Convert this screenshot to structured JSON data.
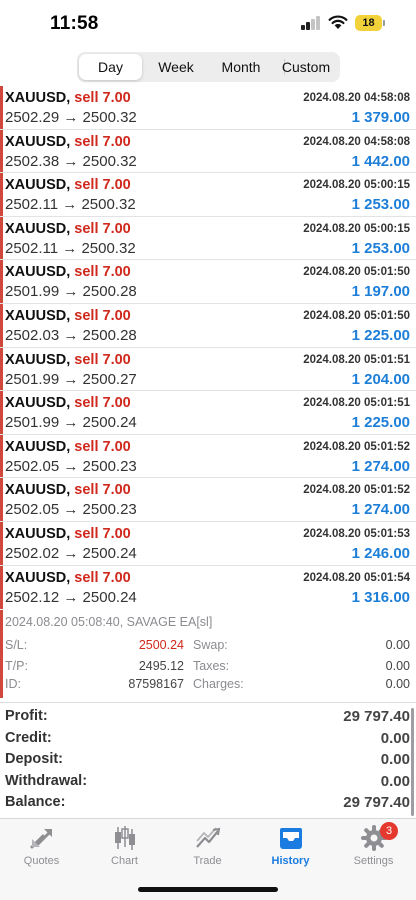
{
  "status": {
    "time": "11:58",
    "battery": "18"
  },
  "period_tabs": [
    {
      "label": "Day",
      "active": true
    },
    {
      "label": "Week",
      "active": false
    },
    {
      "label": "Month",
      "active": false
    },
    {
      "label": "Custom",
      "active": false
    }
  ],
  "deals": [
    {
      "symbol": "XAUUSD,",
      "side": "sell 7.00",
      "time": "2024.08.20 04:58:08",
      "prices": "2502.29 → 2500.32",
      "profit": "1 379.00"
    },
    {
      "symbol": "XAUUSD,",
      "side": "sell 7.00",
      "time": "2024.08.20 04:58:08",
      "prices": "2502.38 → 2500.32",
      "profit": "1 442.00"
    },
    {
      "symbol": "XAUUSD,",
      "side": "sell 7.00",
      "time": "2024.08.20 05:00:15",
      "prices": "2502.11 → 2500.32",
      "profit": "1 253.00"
    },
    {
      "symbol": "XAUUSD,",
      "side": "sell 7.00",
      "time": "2024.08.20 05:00:15",
      "prices": "2502.11 → 2500.32",
      "profit": "1 253.00"
    },
    {
      "symbol": "XAUUSD,",
      "side": "sell 7.00",
      "time": "2024.08.20 05:01:50",
      "prices": "2501.99 → 2500.28",
      "profit": "1 197.00"
    },
    {
      "symbol": "XAUUSD,",
      "side": "sell 7.00",
      "time": "2024.08.20 05:01:50",
      "prices": "2502.03 → 2500.28",
      "profit": "1 225.00"
    },
    {
      "symbol": "XAUUSD,",
      "side": "sell 7.00",
      "time": "2024.08.20 05:01:51",
      "prices": "2501.99 → 2500.27",
      "profit": "1 204.00"
    },
    {
      "symbol": "XAUUSD,",
      "side": "sell 7.00",
      "time": "2024.08.20 05:01:51",
      "prices": "2501.99 → 2500.24",
      "profit": "1 225.00"
    },
    {
      "symbol": "XAUUSD,",
      "side": "sell 7.00",
      "time": "2024.08.20 05:01:52",
      "prices": "2502.05 → 2500.23",
      "profit": "1 274.00"
    },
    {
      "symbol": "XAUUSD,",
      "side": "sell 7.00",
      "time": "2024.08.20 05:01:52",
      "prices": "2502.05 → 2500.23",
      "profit": "1 274.00"
    },
    {
      "symbol": "XAUUSD,",
      "side": "sell 7.00",
      "time": "2024.08.20 05:01:53",
      "prices": "2502.02 → 2500.24",
      "profit": "1 246.00"
    },
    {
      "symbol": "XAUUSD,",
      "side": "sell 7.00",
      "time": "2024.08.20 05:01:54",
      "prices": "2502.12 → 2500.24",
      "profit": "1 316.00"
    }
  ],
  "detail": {
    "header": "2024.08.20 05:08:40, SAVAGE EA[sl]",
    "sl_label": "S/L:",
    "sl_value": "2500.24",
    "tp_label": "T/P:",
    "tp_value": "2495.12",
    "id_label": "ID:",
    "id_value": "87598167",
    "swap_label": "Swap:",
    "swap_value": "0.00",
    "taxes_label": "Taxes:",
    "taxes_value": "0.00",
    "charges_label": "Charges:",
    "charges_value": "0.00"
  },
  "totals": [
    {
      "label": "Profit:",
      "value": "29 797.40"
    },
    {
      "label": "Credit:",
      "value": "0.00"
    },
    {
      "label": "Deposit:",
      "value": "0.00"
    },
    {
      "label": "Withdrawal:",
      "value": "0.00"
    },
    {
      "label": "Balance:",
      "value": "29 797.40"
    }
  ],
  "tabbar": [
    {
      "label": "Quotes",
      "icon": "quotes-icon",
      "active": false
    },
    {
      "label": "Chart",
      "icon": "chart-icon",
      "active": false
    },
    {
      "label": "Trade",
      "icon": "trade-icon",
      "active": false
    },
    {
      "label": "History",
      "icon": "history-icon",
      "active": true
    },
    {
      "label": "Settings",
      "icon": "settings-icon",
      "active": false,
      "badge": "3"
    }
  ],
  "colors": {
    "sell": "#d0281c",
    "profit": "#1d7ed8",
    "accent": "#1a7ce0",
    "badge": "#e5392f"
  }
}
